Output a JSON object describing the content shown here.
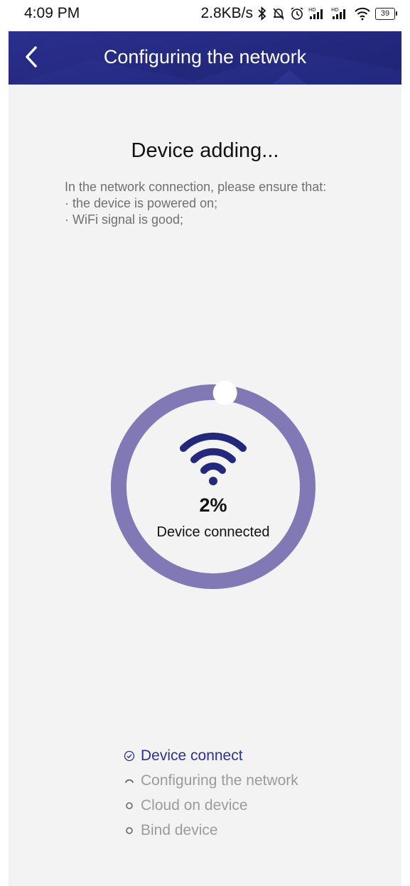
{
  "status_bar": {
    "time": "4:09 PM",
    "net_speed": "2.8KB/s",
    "battery": "39",
    "icons": [
      "bluetooth-icon",
      "mute-icon",
      "alarm-icon",
      "hd-signal-icon",
      "hd-signal-icon",
      "wifi-icon",
      "battery-icon"
    ]
  },
  "header": {
    "title": "Configuring the network",
    "back_icon": "chevron-left-icon"
  },
  "main": {
    "heading": "Device adding...",
    "instructions": [
      "In the network connection, please ensure that:",
      "· the device is powered on;",
      "· WiFi signal is good;"
    ],
    "progress": {
      "percent_label": "2%",
      "value_fraction": 0.02,
      "status": "Device connected",
      "ring_color": "#8079b6",
      "knob_color": "#ffffff",
      "icon": "wifi-icon",
      "icon_color": "#23287d"
    },
    "steps": [
      {
        "label": "Device connect",
        "state": "done",
        "icon": "check-circle-icon"
      },
      {
        "label": "Configuring the network",
        "state": "in-progress",
        "icon": "spinner-icon"
      },
      {
        "label": "Cloud on device",
        "state": "pending",
        "icon": "circle-icon"
      },
      {
        "label": "Bind device",
        "state": "pending",
        "icon": "circle-icon"
      }
    ]
  },
  "colors": {
    "accent": "#23287d",
    "active_step": "#2c3192",
    "inactive_step": "#9b9b9b",
    "background": "#f3f3f4"
  }
}
